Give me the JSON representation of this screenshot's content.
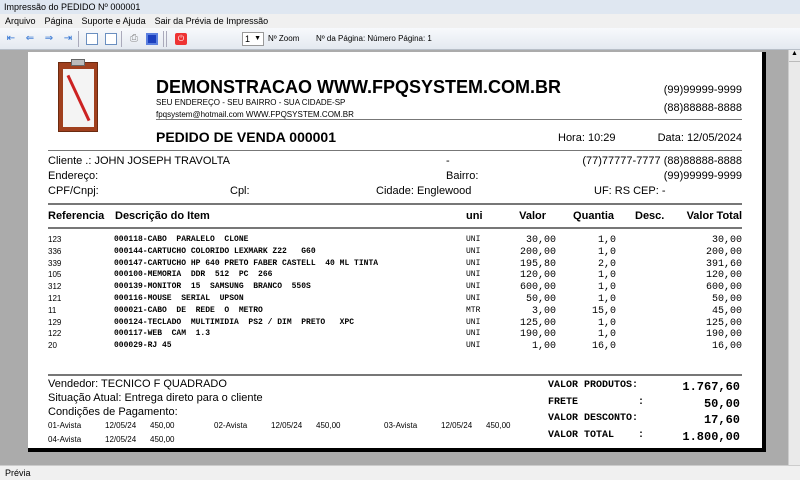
{
  "window": {
    "title": "Impressão do PEDIDO Nº 000001"
  },
  "menu": [
    "Arquivo",
    "Página",
    "Suporte e Ajuda",
    "Sair da Prévia de Impressão"
  ],
  "toolbar": {
    "zoom_value": "1",
    "zoom_label": "Nº Zoom",
    "page_info": "Nº da Página: Número Página: 1"
  },
  "company": {
    "name": "DEMONSTRACAO WWW.FPQSYSTEM.COM.BR",
    "address": "SEU ENDEREÇO - SEU BAIRRO - SUA CIDADE-SP",
    "contact": "fpqsystem@hotmail.com  WWW.FPQSYSTEM.COM.BR",
    "phone1": "(99)99999-9999",
    "phone2": "(88)88888-8888"
  },
  "order": {
    "title": "PEDIDO DE VENDA 000001",
    "hora": "Hora: 10:29",
    "data": "Data: 12/05/2024"
  },
  "client": {
    "cliente": "Cliente   .: JOHN JOSEPH TRAVOLTA",
    "dash": "-",
    "phones": "(77)77777-7777  (88)88888-8888",
    "endereco": "Endereço:",
    "bairro": "Bairro:",
    "phone3": "(99)99999-9999",
    "cpf": "CPF/Cnpj:",
    "cpl": "Cpl:",
    "cidade": "Cidade: Englewood",
    "uf": "UF: RS CEP:    -"
  },
  "table": {
    "headers": [
      "Referencia",
      "Descrição do Item",
      "uni",
      "Valor",
      "Quantia",
      "Desc.",
      "Valor Total"
    ],
    "rows": [
      [
        "123",
        "000118-CABO  PARALELO  CLONE",
        "UNI",
        "30,00",
        "1,0",
        "30,00"
      ],
      [
        "336",
        "000144-CARTUCHO COLORIDO LEXMARK Z22   G60",
        "UNI",
        "200,00",
        "1,0",
        "200,00"
      ],
      [
        "339",
        "000147-CARTUCHO HP 640 PRETO FABER CASTELL  40 ML TINTA",
        "UNI",
        "195,80",
        "2,0",
        "391,60"
      ],
      [
        "105",
        "000100-MEMORIA  DDR  512  PC  266",
        "UNI",
        "120,00",
        "1,0",
        "120,00"
      ],
      [
        "312",
        "000139-MONITOR  15  SAMSUNG  BRANCO  550S",
        "UNI",
        "600,00",
        "1,0",
        "600,00"
      ],
      [
        "121",
        "000116-MOUSE  SERIAL  UPSON",
        "UNI",
        "50,00",
        "1,0",
        "50,00"
      ],
      [
        "11",
        "000021-CABO  DE  REDE  O  METRO",
        "MTR",
        "3,00",
        "15,0",
        "45,00"
      ],
      [
        "129",
        "000124-TECLADO  MULTIMIDIA  PS2 / DIM  PRETO   XPC",
        "UNI",
        "125,00",
        "1,0",
        "125,00"
      ],
      [
        "122",
        "000117-WEB  CAM  1.3",
        "UNI",
        "190,00",
        "1,0",
        "190,00"
      ],
      [
        "20",
        "000029-RJ 45",
        "UNI",
        "1,00",
        "16,0",
        "16,00"
      ]
    ]
  },
  "footer": {
    "vendedor": "Vendedor: TECNICO F QUADRADO",
    "situacao": "Situação Atual: Entrega direto para o cliente",
    "condicoes": "Condições de Pagamento:",
    "parcelas": [
      [
        "01-Avista",
        "12/05/24",
        "450,00"
      ],
      [
        "02-Avista",
        "12/05/24",
        "450,00"
      ],
      [
        "03-Avista",
        "12/05/24",
        "450,00"
      ],
      [
        "04-Avista",
        "12/05/24",
        "450,00"
      ]
    ],
    "totals": [
      [
        "VALOR PRODUTOS:",
        "1.767,60"
      ],
      [
        "FRETE          :",
        "50,00"
      ],
      [
        "VALOR DESCONTO:",
        "17,60"
      ],
      [
        "VALOR TOTAL    :",
        "1.800,00"
      ]
    ]
  },
  "status": "Prévia"
}
